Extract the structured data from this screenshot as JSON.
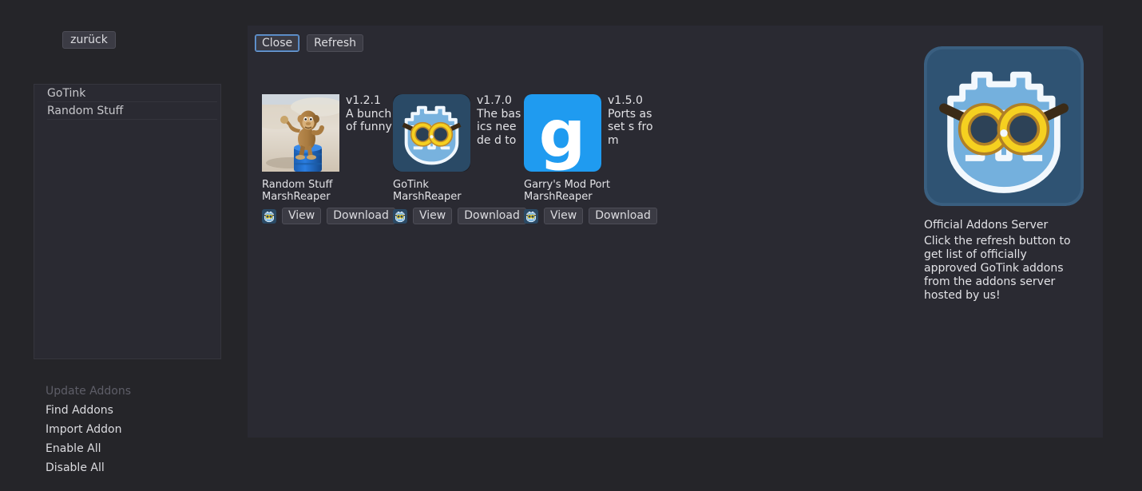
{
  "back_button": {
    "label": "zurück"
  },
  "sidebar": {
    "list_items": [
      {
        "label": "GoTink"
      },
      {
        "label": "Random Stuff"
      }
    ],
    "menu_items": [
      {
        "label": "Update Addons",
        "disabled": true
      },
      {
        "label": "Find Addons",
        "disabled": false
      },
      {
        "label": "Import Addon",
        "disabled": false
      },
      {
        "label": "Enable All",
        "disabled": false
      },
      {
        "label": "Disable All",
        "disabled": false
      }
    ]
  },
  "toolbar": {
    "close_label": "Close",
    "refresh_label": "Refresh"
  },
  "cards": [
    {
      "version": "v1.2.1",
      "description": "A bunch of funny",
      "title": "Random Stuff",
      "author": "MarshReaper",
      "view_label": "View",
      "download_label": "Download",
      "thumbnail": "monkey-on-barrel-render",
      "icon": "gotink-icon"
    },
    {
      "version": "v1.7.0",
      "description": "The basics neede d to",
      "title": "GoTink",
      "author": "MarshReaper",
      "view_label": "View",
      "download_label": "Download",
      "thumbnail": "gotink-icon",
      "icon": "gotink-icon"
    },
    {
      "version": "v1.5.0",
      "description": "Ports asset s from",
      "title": "Garry's Mod Port",
      "author": "MarshReaper",
      "view_label": "View",
      "download_label": "Download",
      "thumbnail": "garrys-mod-g-logo",
      "icon": "gotink-icon"
    }
  ],
  "server_info": {
    "icon": "gotink-icon",
    "title": "Official Addons Server",
    "description": "Click the refresh button to get list of officially approved GoTink addons from the addons server hosted by us!"
  },
  "colors": {
    "window_background": "#252529",
    "panel_background": "#2a2a32",
    "button_face": "#3b3b44",
    "focus_outline": "#6f9fd8",
    "text_primary": "#e2e2e6",
    "text_disabled": "#5e5e68",
    "gotink_blue": "#6aa8d8",
    "gotink_badge_bg": "#2a4a66",
    "gmod_blue": "#1f9bf0",
    "goggle_yellow": "#f5d020"
  }
}
